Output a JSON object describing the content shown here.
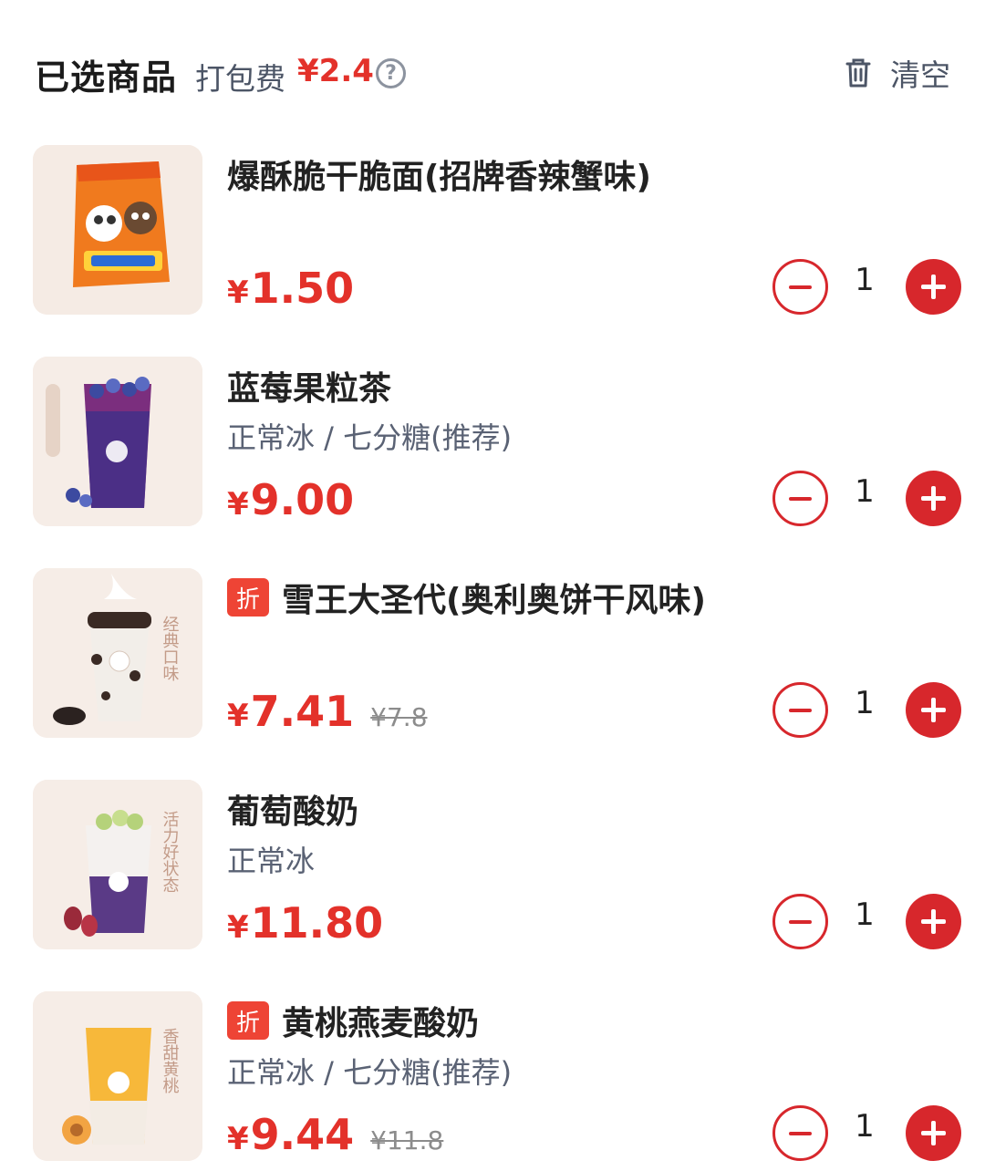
{
  "header": {
    "title": "已选商品",
    "pack_label": "打包费",
    "pack_fee": "¥2.4",
    "help_glyph": "?",
    "clear_label": "清空"
  },
  "items": [
    {
      "name": "爆酥脆干脆面(招牌香辣蟹味)",
      "discount_badge": "",
      "spec": "",
      "yen": "¥",
      "price": "1.50",
      "original_price": "",
      "qty": "1",
      "image": "spicy-crab-noodle-snack-pack"
    },
    {
      "name": "蓝莓果粒茶",
      "discount_badge": "",
      "spec": "正常冰 / 七分糖(推荐)",
      "yen": "¥",
      "price": "9.00",
      "original_price": "",
      "qty": "1",
      "image": "blueberry-fruit-tea-cup"
    },
    {
      "name": "雪王大圣代(奥利奥饼干风味)",
      "discount_badge": "折",
      "spec": "",
      "yen": "¥",
      "price": "7.41",
      "original_price": "¥7.8",
      "qty": "1",
      "image": "oreo-sundae-cup",
      "image_caption": "经典口味"
    },
    {
      "name": "葡萄酸奶",
      "discount_badge": "",
      "spec": "正常冰",
      "yen": "¥",
      "price": "11.80",
      "original_price": "",
      "qty": "1",
      "image": "grape-yogurt-cup",
      "image_caption": "活力好状态"
    },
    {
      "name": "黄桃燕麦酸奶",
      "discount_badge": "折",
      "spec": "正常冰 / 七分糖(推荐)",
      "yen": "¥",
      "price": "9.44",
      "original_price": "¥11.8",
      "qty": "1",
      "image": "yellow-peach-oat-yogurt-cup",
      "image_caption": "香甜黄桃"
    }
  ],
  "colors": {
    "accent_red": "#d7272c",
    "price_red": "#e3312a",
    "badge_red": "#ee4435",
    "muted_text": "#4c5566"
  }
}
